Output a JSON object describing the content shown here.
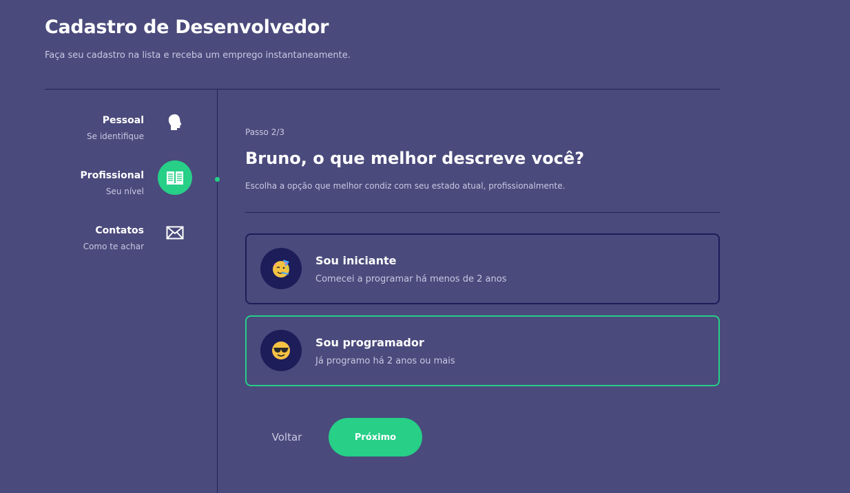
{
  "header": {
    "title": "Cadastro de Desenvolvedor",
    "subtitle": "Faça seu cadastro na lista e receba um emprego instantaneamente."
  },
  "steps": [
    {
      "title": "Pessoal",
      "subtitle": "Se identifique",
      "icon": "head-icon",
      "active": false
    },
    {
      "title": "Profissional",
      "subtitle": "Seu nível",
      "icon": "book-icon",
      "active": true
    },
    {
      "title": "Contatos",
      "subtitle": "Como te achar",
      "icon": "envelope-icon",
      "active": false
    }
  ],
  "main": {
    "step_counter": "Passo 2/3",
    "question": "Bruno, o que melhor descreve você?",
    "question_sub": "Escolha a opção que melhor condiz com seu estado atual, profissionalmente.",
    "options": [
      {
        "title": "Sou iniciante",
        "subtitle": "Comecei a programar há menos de 2 anos",
        "icon": "party-face-icon",
        "selected": false
      },
      {
        "title": "Sou programador",
        "subtitle": "Já programo há 2 anos ou mais",
        "icon": "sunglasses-face-icon",
        "selected": true
      }
    ]
  },
  "actions": {
    "back_label": "Voltar",
    "next_label": "Próximo"
  },
  "colors": {
    "background": "#4a4a7c",
    "accent": "#27cf87",
    "dark": "#1d1d5a",
    "muted_text": "#c9c9e4"
  }
}
